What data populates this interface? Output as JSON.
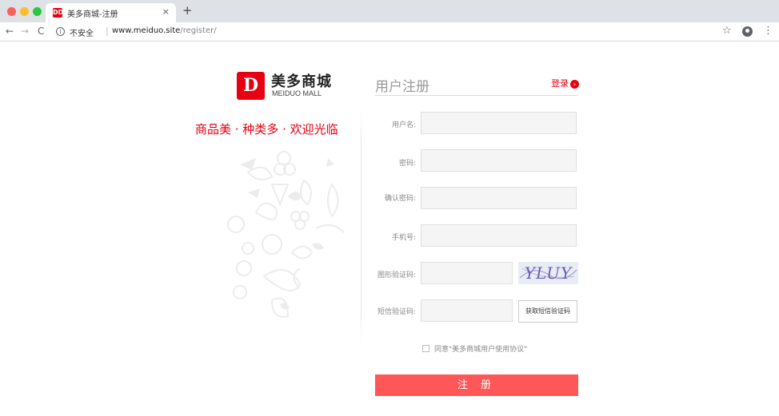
{
  "browser": {
    "tab": {
      "favicon": "DD",
      "title": "美多商城-注册",
      "close": "×"
    },
    "newtab": "+",
    "nav": {
      "back": "←",
      "forward": "→",
      "reload": "C"
    },
    "security": {
      "icon": "ⓘ",
      "label": "不安全"
    },
    "url": {
      "host": "www.meiduo.site",
      "path": "/register/"
    },
    "icons": [
      "info-icon",
      "star-icon",
      "account-icon",
      "menu-icon"
    ],
    "star": "☆",
    "menu": "⋮"
  },
  "logo": {
    "mark": "D",
    "name_cn": "美多商城",
    "name_en": "MEIDUO MALL"
  },
  "slogan": "商品美 · 种类多 · 欢迎光临",
  "form": {
    "title": "用户注册",
    "login_link": "登录",
    "login_arrow": "›",
    "fields": [
      {
        "label": "用户名:",
        "value": ""
      },
      {
        "label": "密码:",
        "value": ""
      },
      {
        "label": "确认密码:",
        "value": ""
      },
      {
        "label": "手机号:",
        "value": ""
      },
      {
        "label": "图形验证码:",
        "value": ""
      },
      {
        "label": "短信验证码:",
        "value": ""
      }
    ],
    "captcha_text": "YLUY",
    "sms_button": "获取短信验证码",
    "agreement": "同意\"美多商城用户使用协议\"",
    "submit": "注 册"
  },
  "colors": {
    "brand": "#e60012",
    "submit": "#ff5757",
    "input_bg": "#f5f5f5"
  }
}
